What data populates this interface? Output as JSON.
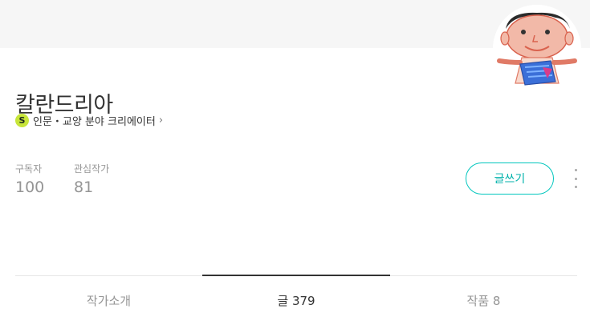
{
  "profile": {
    "name": "칼란드리아",
    "creator_badge": "S",
    "creator_category": "인문・교양 분야 크리에이터",
    "chevron": "›"
  },
  "stats": {
    "subscribers_label": "구독자",
    "subscribers_value": "100",
    "following_label": "관심작가",
    "following_value": "81"
  },
  "actions": {
    "write_label": "글쓰기",
    "more_icon": "more-vertical-icon"
  },
  "tabs": [
    {
      "label": "작가소개",
      "active": false
    },
    {
      "label": "글 379",
      "active": true
    },
    {
      "label": "작품 8",
      "active": false
    }
  ],
  "colors": {
    "accent": "#00c6be",
    "badge": "#c7e53a",
    "cover": "#f6f6f6",
    "muted_text": "#959595"
  }
}
